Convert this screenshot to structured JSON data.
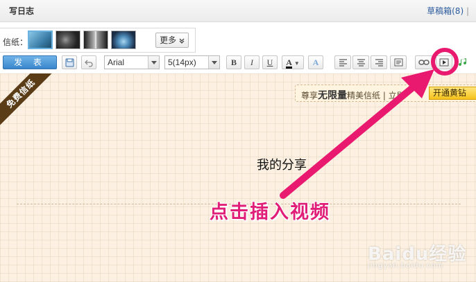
{
  "header": {
    "title": "写日志",
    "drafts_link": "草稿箱(8)",
    "separator": "|"
  },
  "stationery": {
    "label": "信纸：",
    "more_button": "更多",
    "more_arrow": "chevron-double-down-icon"
  },
  "toolbar": {
    "publish_label": "发 表",
    "font_family": "Arial",
    "font_size": "5(14px)",
    "bold": "B",
    "italic": "I",
    "underline": "U",
    "font_color_letter": "A",
    "highlight_letter": "A",
    "icons": [
      "save-icon",
      "undo-icon",
      "align-left-icon",
      "align-center-icon",
      "align-right-icon",
      "insert-image-icon",
      "insert-link-icon",
      "insert-video-icon",
      "insert-music-icon"
    ]
  },
  "editor": {
    "ribbon_text": "免费信纸",
    "promo": {
      "prefix": "尊享",
      "highlight": "无限量",
      "suffix": "精美信纸 | 立即",
      "vip_button": "开通黄钻"
    },
    "body_text": "我的分享"
  },
  "annotation": {
    "text": "点击插入视频",
    "color": "#e11e77"
  },
  "watermark": {
    "brand": "Baidu经验",
    "sub": "jingyan.baidu.com"
  }
}
